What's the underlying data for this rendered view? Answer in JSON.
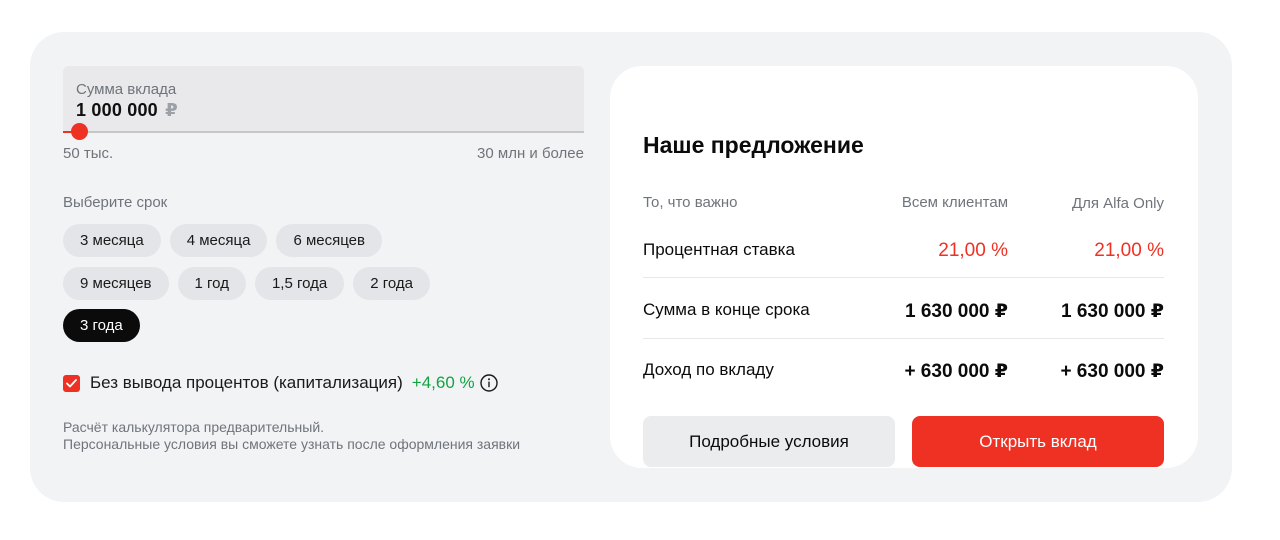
{
  "amount": {
    "label": "Сумма вклада",
    "value": "1 000 000",
    "currency": "₽",
    "slider_fraction": 0.03,
    "min_label": "50 тыс.",
    "max_label": "30 млн и более"
  },
  "term": {
    "title": "Выберите срок",
    "options": [
      "3 месяца",
      "4 месяца",
      "6 месяцев",
      "9 месяцев",
      "1 год",
      "1,5 года",
      "2 года",
      "3 года"
    ],
    "selected": "3 года"
  },
  "capitalization": {
    "checked": true,
    "label": "Без вывода процентов (капитализация)",
    "rate": "+4,60 %"
  },
  "note": {
    "line1": "Расчёт калькулятора предварительный.",
    "line2": "Персональные условия вы сможете узнать после оформления заявки"
  },
  "offer": {
    "title": "Наше предложение",
    "columns": [
      "То, что важно",
      "Всем клиентам",
      "Для Alfa Only"
    ],
    "rows": [
      {
        "label": "Процентная ставка",
        "all": "21,00 %",
        "alfa": "21,00 %"
      },
      {
        "label": "Сумма в конце срока",
        "all": "1 630 000 ₽",
        "alfa": "1 630 000 ₽"
      },
      {
        "label": "Доход по вкладу",
        "all": "+ 630 000 ₽",
        "alfa": "+ 630 000 ₽"
      }
    ],
    "details_button": "Подробные условия",
    "open_button": "Открыть вклад"
  },
  "colors": {
    "accent": "#ef3124",
    "positive": "#13a442",
    "card_bg": "#f2f3f5",
    "chip_bg": "#e4e5e8",
    "chip_active_bg": "#0b0b0b"
  },
  "icons": {
    "checkbox": "check-icon",
    "info": "info-icon"
  }
}
